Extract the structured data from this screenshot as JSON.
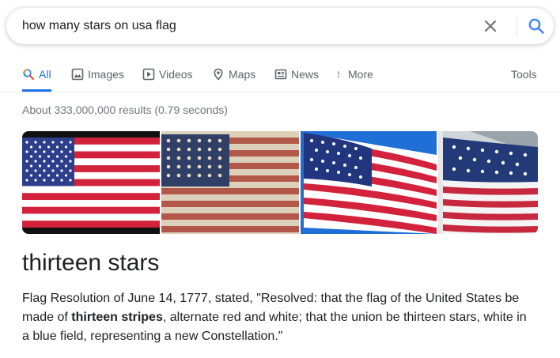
{
  "search": {
    "query": "how many stars on usa flag"
  },
  "tabs": [
    {
      "label": "All",
      "icon": "search-icon",
      "active": true
    },
    {
      "label": "Images",
      "icon": "image-icon"
    },
    {
      "label": "Videos",
      "icon": "play-icon"
    },
    {
      "label": "Maps",
      "icon": "map-pin-icon"
    },
    {
      "label": "News",
      "icon": "news-icon"
    },
    {
      "label": "More",
      "icon": "more-vert-icon"
    }
  ],
  "tools_label": "Tools",
  "result_stats": "About 333,000,000 results (0.79 seconds)",
  "images": [
    {
      "name": "us-flag-flat"
    },
    {
      "name": "us-flag-vintage-48-stars"
    },
    {
      "name": "us-flag-waving"
    },
    {
      "name": "us-flag-on-building"
    }
  ],
  "answer": {
    "title": "thirteen stars",
    "text_before": "Flag Resolution of June 14, 1777, stated, \"Resolved: that the flag of the United States be made of ",
    "bold": "thirteen stripes",
    "text_after": ", alternate red and white; that the union be thirteen stars, white in a blue field, representing a new Constellation.\""
  },
  "colors": {
    "accent": "#1a73e8",
    "flag_red": "#d3233c",
    "flag_blue": "#2c3e8c"
  }
}
